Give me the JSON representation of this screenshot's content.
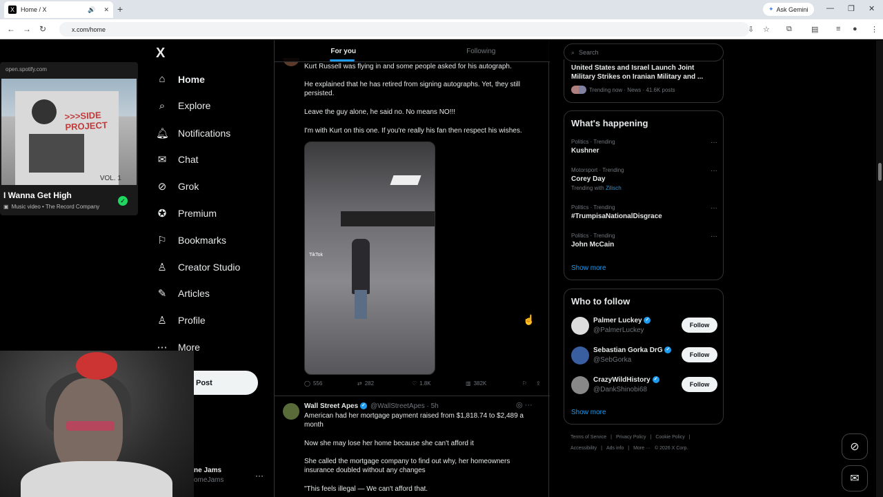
{
  "browser": {
    "tab_title": "Home / X",
    "tab_logo": "X",
    "new_tab": "+",
    "gemini": "Ask Gemini",
    "url": "x.com/home"
  },
  "spotify": {
    "source": "open.spotify.com",
    "album_sign": ">>>SIDE PROJECT",
    "album_vol": "VOL. 1",
    "song": "I Wanna Get High",
    "meta": "Music video • The Record Company"
  },
  "nav": {
    "logo": "X",
    "items": [
      {
        "label": "Home",
        "icon": "home-icon"
      },
      {
        "label": "Explore",
        "icon": "search-icon"
      },
      {
        "label": "Notifications",
        "icon": "bell-icon"
      },
      {
        "label": "Chat",
        "icon": "mail-icon"
      },
      {
        "label": "Grok",
        "icon": "grok-icon"
      },
      {
        "label": "Premium",
        "icon": "premium-icon"
      },
      {
        "label": "Bookmarks",
        "icon": "bookmark-icon"
      },
      {
        "label": "Creator Studio",
        "icon": "creator-icon"
      },
      {
        "label": "Articles",
        "icon": "articles-icon"
      },
      {
        "label": "Profile",
        "icon": "profile-icon"
      },
      {
        "label": "More",
        "icon": "more-icon"
      }
    ],
    "post": "Post",
    "account_name": "ne Jams",
    "account_handle": "omeJams",
    "account_more": "···"
  },
  "feed": {
    "tabs": [
      "For you",
      "Following"
    ],
    "post1": {
      "line1": "Kurt Russell was flying in and some people asked for his autograph.",
      "line2": "He explained that he has retired from signing autographs. Yet, they still persisted.",
      "line3": "Leave the guy alone, he said no. No means NO!!!",
      "line4": "I'm with Kurt on this one. If you're really his fan then respect his wishes.",
      "video_watermark": "TikTok",
      "replies": "556",
      "reposts": "282",
      "likes": "1.8K",
      "views": "382K"
    },
    "post2": {
      "name": "Wall Street Apes",
      "handle": "@WallStreetApes · 5h",
      "line1": "American had her mortgage payment raised from $1,818.74 to $2,489 a month",
      "line2": "Now she may lose her home because she can't afford it",
      "line3": "She called the mortgage company to find out why, her homeowners insurance doubled without any changes",
      "line4": "\"This feels illegal — We can't afford that."
    }
  },
  "right": {
    "search_placeholder": "Search",
    "top_trend": {
      "headline": "United States and Israel Launch Joint Military Strikes on Iranian Military and ...",
      "meta": "Trending now · News · 41.6K posts"
    },
    "happening_title": "What's happening",
    "trends": [
      {
        "cat": "Politics · Trending",
        "name": "Kushner",
        "sub": ""
      },
      {
        "cat": "Motorsport · Trending",
        "name": "Corey Day",
        "sub": "Trending with",
        "sub_link": "Zilisch"
      },
      {
        "cat": "Politics · Trending",
        "name": "#TrumpisaNationalDisgrace",
        "sub": ""
      },
      {
        "cat": "Politics · Trending",
        "name": "John McCain",
        "sub": ""
      }
    ],
    "show_more": "Show more",
    "follow_title": "Who to follow",
    "follows": [
      {
        "name": "Palmer Luckey",
        "handle": "@PalmerLuckey"
      },
      {
        "name": "Sebastian Gorka DrG",
        "handle": "@SebGorka"
      },
      {
        "name": "CrazyWildHistory",
        "handle": "@DankShinobi68"
      }
    ],
    "follow_label": "Follow",
    "footer1": [
      "Terms of Service",
      "|",
      "Privacy Policy",
      "|",
      "Cookie Policy",
      "|"
    ],
    "footer2": [
      "Accessibility",
      "|",
      "Ads info",
      "|",
      "More ···",
      "© 2026 X Corp."
    ]
  }
}
